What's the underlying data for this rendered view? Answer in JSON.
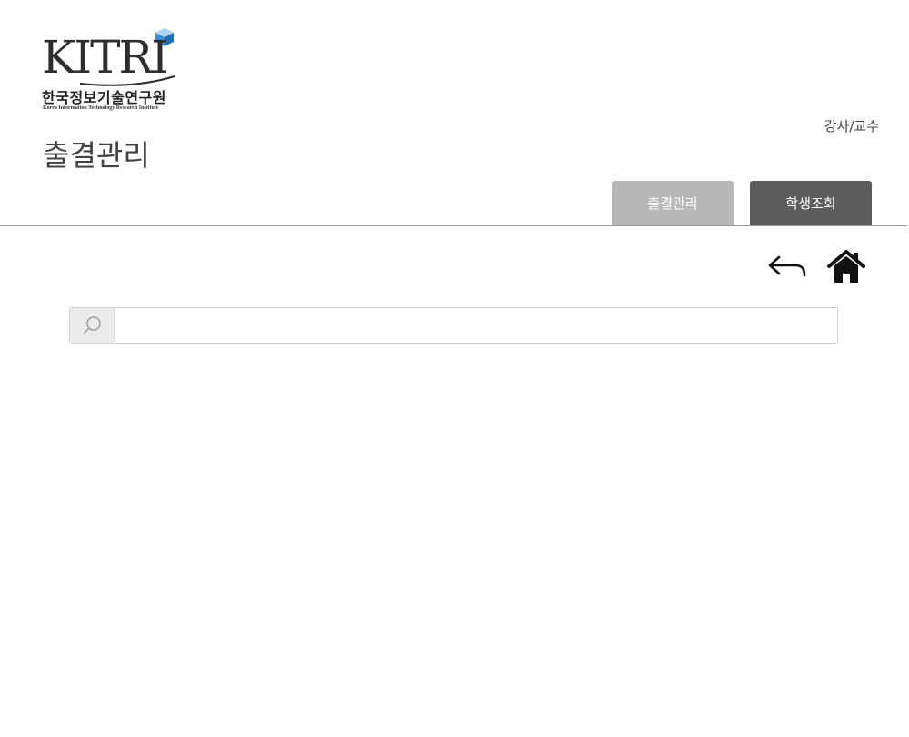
{
  "brand": {
    "wordmark": "KITRI",
    "korean_name": "한국정보기술연구원",
    "english_name": "Korea Information Technology Research Institute",
    "cube_color": "#5aa3dc"
  },
  "header": {
    "page_title": "출결관리",
    "user_role": "강사/교수"
  },
  "tabs": [
    {
      "label": "출결관리",
      "color": "#b8b8b8"
    },
    {
      "label": "학생조회",
      "color": "#5c5c5c"
    }
  ],
  "actions": {
    "back_icon": "back-arrow-icon",
    "home_icon": "home-icon"
  },
  "search": {
    "icon": "search-icon",
    "value": "",
    "placeholder": ""
  }
}
